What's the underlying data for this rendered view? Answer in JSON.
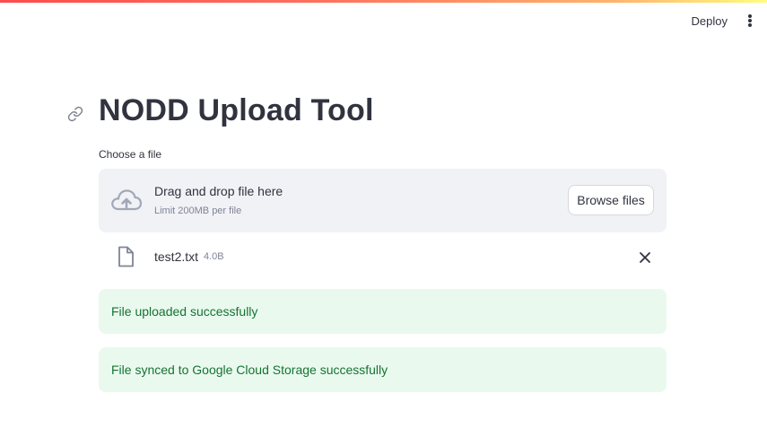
{
  "header": {
    "deploy_label": "Deploy",
    "menu_icon": "vertical-ellipsis-icon"
  },
  "page": {
    "title": "NODD Upload Tool",
    "anchor_icon": "link-icon"
  },
  "uploader": {
    "label": "Choose a file",
    "dropzone_text": "Drag and drop file here",
    "limit_text": "Limit 200MB per file",
    "browse_label": "Browse files",
    "upload_icon": "cloud-upload-icon"
  },
  "uploaded_file": {
    "name": "test2.txt",
    "size": "4.0B",
    "file_icon": "file-icon",
    "remove_icon": "close-icon"
  },
  "alerts": [
    {
      "text": "File uploaded successfully",
      "kind": "success"
    },
    {
      "text": "File synced to Google Cloud Storage successfully",
      "kind": "success"
    }
  ],
  "colors": {
    "accent_gradient": [
      "#ff4b4b",
      "#fffd80"
    ],
    "success_bg": "#e9f9ee",
    "success_text": "#177233",
    "dropzone_bg": "#f0f2f6"
  }
}
